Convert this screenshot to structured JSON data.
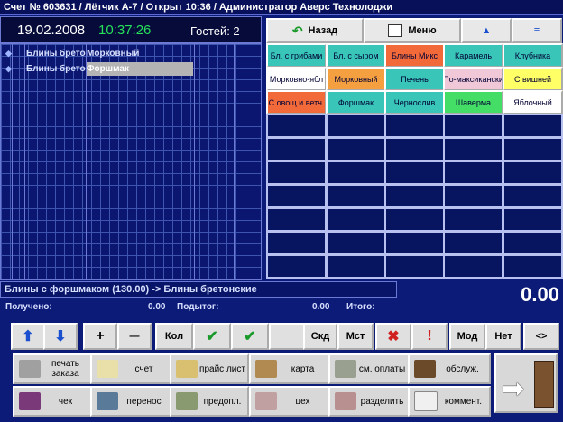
{
  "title": "Счет № 603631 / Лётчик А-7 / Открыт 10:36 / Администратор Аверс Технолоджи",
  "info": {
    "date": "19.02.2008",
    "time": "10:37:26",
    "guests": "Гостей: 2"
  },
  "order_rows": [
    {
      "mark": "◆",
      "name": "Блины брето",
      "mod": "Морковный",
      "selected": false
    },
    {
      "mark": "◆",
      "name": "Блины брето",
      "mod": "Форшмак",
      "selected": true
    }
  ],
  "nav": {
    "back": "Назад",
    "menu": "Меню",
    "up": "▲",
    "list": "≡"
  },
  "tiles": [
    {
      "label": "Бл. с грибами",
      "bg": "#39c6b8"
    },
    {
      "label": "Бл. с сыром",
      "bg": "#39c6b8"
    },
    {
      "label": "Блины Микс",
      "bg": "#f26a3a"
    },
    {
      "label": "Карамель",
      "bg": "#39c6b8"
    },
    {
      "label": "Клубника",
      "bg": "#39c6b8"
    },
    {
      "label": "Морковно-ябл",
      "bg": "#ffffff"
    },
    {
      "label": "Морковный",
      "bg": "#f4a040"
    },
    {
      "label": "Печень",
      "bg": "#39c6b8"
    },
    {
      "label": "По-максикански",
      "bg": "#f0c8d8"
    },
    {
      "label": "С вишней",
      "bg": "#ffff66"
    },
    {
      "label": "С овощ.и ветч.",
      "bg": "#f26a3a"
    },
    {
      "label": "Форшмак",
      "bg": "#39c6b8"
    },
    {
      "label": "Чернослив",
      "bg": "#39c6b8"
    },
    {
      "label": "Шаверма",
      "bg": "#44dd66"
    },
    {
      "label": "Яблочный",
      "bg": "#ffffff"
    }
  ],
  "status": "Блины с форшмаком (130.00) -> Блины бретонские",
  "total_big": "0.00",
  "sums": {
    "received_label": "Получено:",
    "received": "0.00",
    "subtotal_label": "Подытог:",
    "subtotal": "0.00",
    "total_label": "Итого:"
  },
  "keys": {
    "up": "⬆",
    "down": "⬇",
    "plus": "+",
    "minus": "—",
    "kol": "Кол",
    "ok1": "✔",
    "ok2": "✔",
    "skd": "Скд",
    "mst": "Мст",
    "x": "✖",
    "excl": "!",
    "mod": "Мод",
    "net": "Нет",
    "arrows": "<>"
  },
  "func": {
    "print_order": "печать заказа",
    "bill": "счет",
    "price_list": "прайс лист",
    "card": "карта",
    "change_payment": "см. оплаты",
    "service": "обслуж.",
    "check": "чек",
    "transfer": "перенос",
    "prepay": "предопл.",
    "shop": "цех",
    "split": "разделить",
    "comment": "коммент."
  },
  "colors": {
    "bg": "#0c1a78",
    "accent_green": "#27e05a",
    "check_green": "#1a9a2a",
    "x_red": "#d02020"
  }
}
